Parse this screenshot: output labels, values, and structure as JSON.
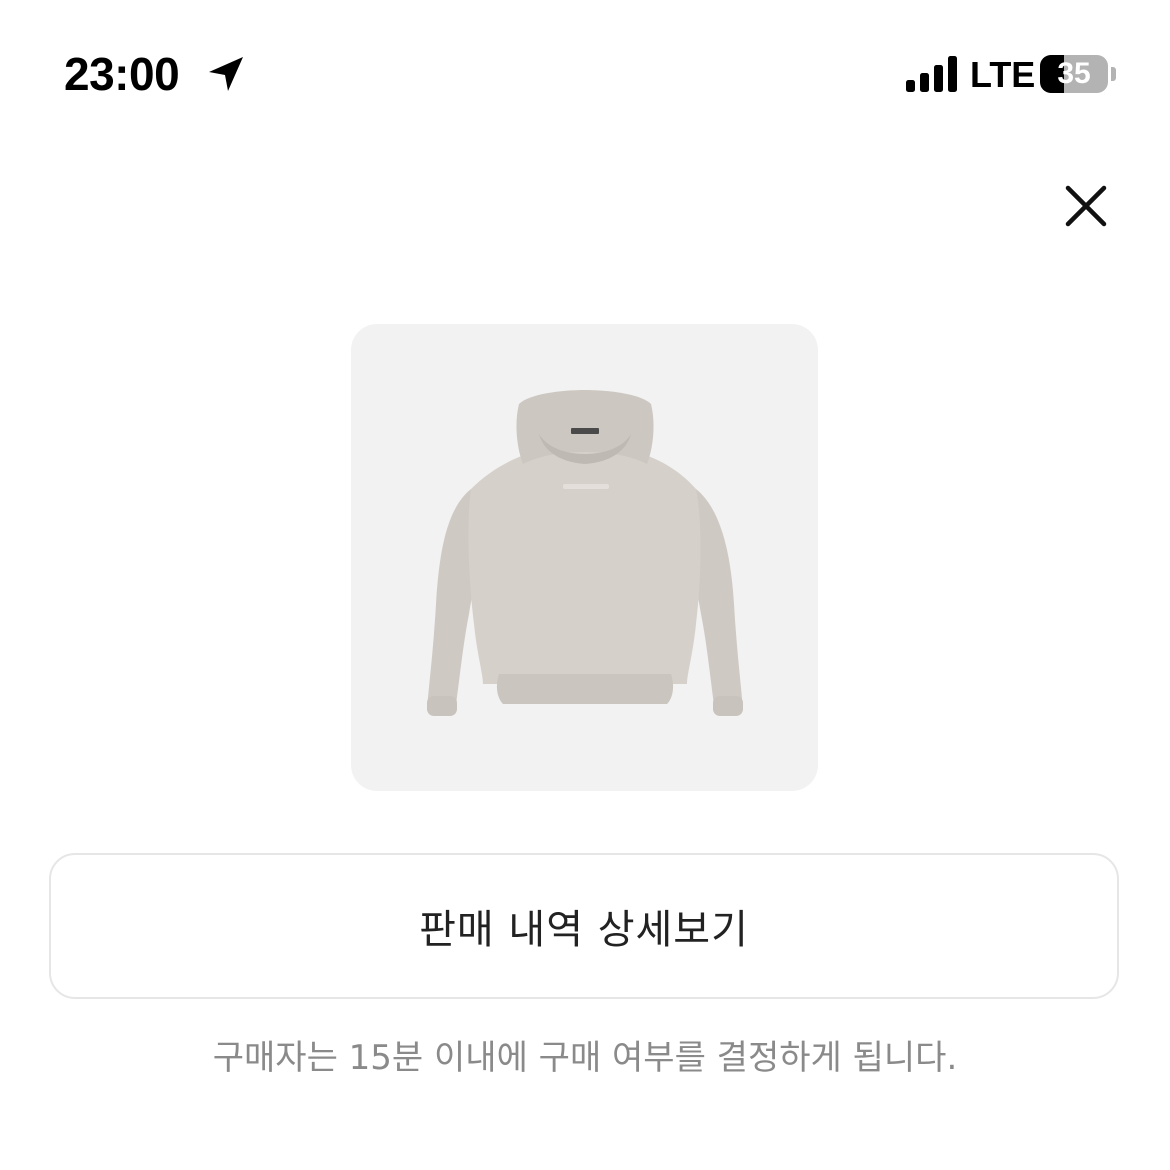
{
  "status_bar": {
    "time": "23:00",
    "location_icon": "location-arrow-icon",
    "signal_icon": "cellular-signal-icon",
    "network": "LTE",
    "battery_level": "35",
    "battery_fraction": 0.35
  },
  "header": {
    "close_icon": "close-icon"
  },
  "product": {
    "image_icon": "hoodie-icon",
    "background_color": "#f2f2f2"
  },
  "actions": {
    "detail_button_label": "판매 내역 상세보기"
  },
  "notice": {
    "text": "구매자는 15분 이내에 구매 여부를 결정하게 됩니다."
  }
}
